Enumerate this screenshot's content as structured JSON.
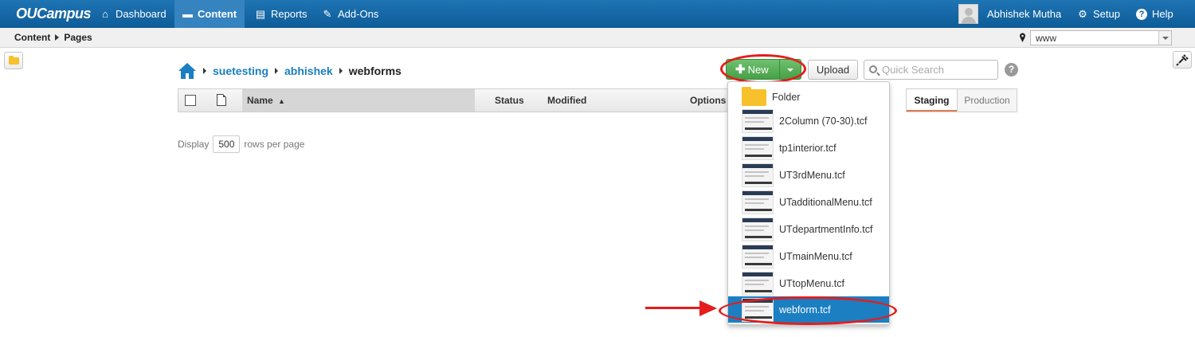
{
  "app": {
    "logo": "OUCampus"
  },
  "topnav": [
    {
      "label": "Dashboard",
      "icon": "home-icon"
    },
    {
      "label": "Content",
      "icon": "folder-icon",
      "active": true
    },
    {
      "label": "Reports",
      "icon": "clipboard-icon"
    },
    {
      "label": "Add-Ons",
      "icon": "pin-icon"
    }
  ],
  "user": {
    "name": "Abhishek Mutha",
    "setup": "Setup",
    "help": "Help"
  },
  "breadcrumb": {
    "first": "Content",
    "second": "Pages"
  },
  "site": {
    "value": "www"
  },
  "path": {
    "p1": "suetesting",
    "p2": "abhishek",
    "current": "webforms"
  },
  "table": {
    "name": "Name",
    "status": "Status",
    "modified": "Modified",
    "options": "Options"
  },
  "toolbar": {
    "new_label": "New",
    "upload_label": "Upload",
    "search_placeholder": "Quick Search"
  },
  "tabs": {
    "staging": "Staging",
    "production": "Production"
  },
  "display": {
    "prefix": "Display",
    "count": "500",
    "suffix": "rows per page"
  },
  "new_menu": [
    {
      "label": "Folder",
      "type": "folder"
    },
    {
      "label": "2Column (70-30).tcf",
      "type": "template"
    },
    {
      "label": "tp1interior.tcf",
      "type": "template"
    },
    {
      "label": "UT3rdMenu.tcf",
      "type": "template"
    },
    {
      "label": "UTadditionalMenu.tcf",
      "type": "template"
    },
    {
      "label": "UTdepartmentInfo.tcf",
      "type": "template"
    },
    {
      "label": "UTmainMenu.tcf",
      "type": "template"
    },
    {
      "label": "UTtopMenu.tcf",
      "type": "template"
    },
    {
      "label": "webform.tcf",
      "type": "template",
      "selected": true
    }
  ],
  "colors": {
    "topbar": "#1667a8",
    "link": "#1b7fc1",
    "new_button": "#46a046",
    "annotation": "#e41d1d",
    "selected": "#1b7fc1"
  }
}
